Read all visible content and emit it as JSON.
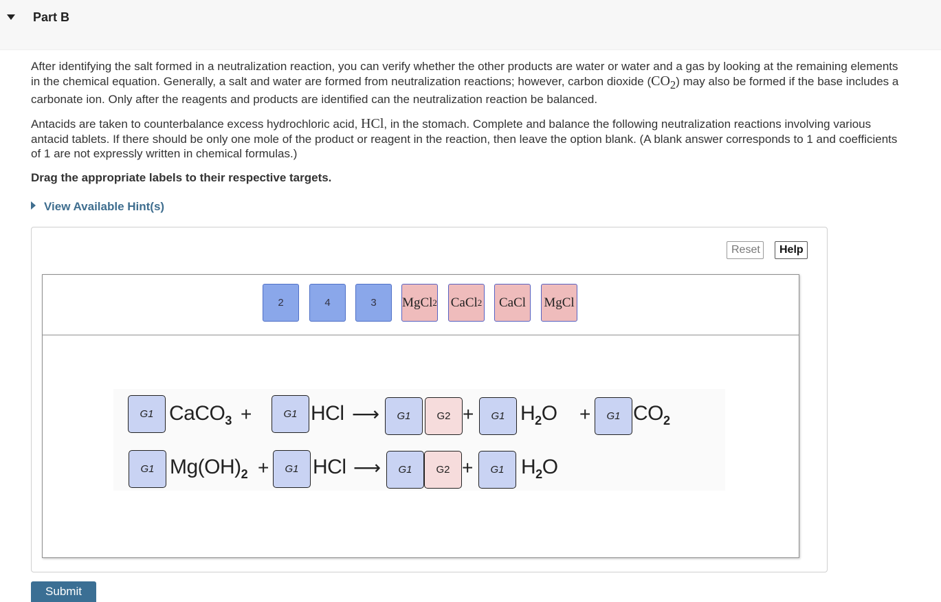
{
  "part": {
    "title": "Part B"
  },
  "paragraph1": {
    "l1": "After identifying the salt formed in a neutralization reaction, you can verify whether the other products are water or water and a gas by looking at the remaining elements",
    "l2a": "in the chemical equation. Generally, a salt and water are formed from neutralization reactions; however, carbon dioxide (",
    "l2chem": "CO",
    "l2sub": "2",
    "l2b": ") may also be formed if the base includes a",
    "l3": "carbonate ion. Only after the reagents and products are identified can the neutralization reaction be balanced."
  },
  "paragraph2": {
    "l1a": "Antacids are taken to counterbalance excess hydrochloric acid, ",
    "l1chem": "HCl",
    "l1b": ", in the stomach. Complete and balance the following neutralization reactions involving various",
    "l2": "antacid tablets. If there should be only one mole of the product or reagent in the reaction, then leave the option blank. (A blank answer corresponds to 1 and coefficients",
    "l3": "of 1 are not expressly written in chemical formulas.)"
  },
  "instruction": "Drag the appropriate labels to their respective targets.",
  "hint_link": "View Available Hint(s)",
  "toolbar": {
    "reset": "Reset",
    "help": "Help"
  },
  "labels": {
    "n1": "2",
    "n2": "4",
    "n3": "3",
    "s1": {
      "base": "MgCl",
      "sub": "2"
    },
    "s2": {
      "base": "CaCl",
      "sub": "2"
    },
    "s3": "CaCl",
    "s4": "MgCl"
  },
  "equations": {
    "g1": "G1",
    "g2": "G2",
    "plus": "+",
    "arrow": "⟶",
    "eq1": {
      "reactant1": {
        "base": "CaCO",
        "sub": "3"
      },
      "reactant2": "HCl",
      "product2": {
        "base": "H",
        "sub": "2",
        "tail": "O"
      },
      "product3": {
        "base": "CO",
        "sub": "2"
      }
    },
    "eq2": {
      "reactant1": {
        "base": "Mg(OH)",
        "sub": "2"
      },
      "reactant2": "HCl",
      "product2": {
        "base": "H",
        "sub": "2",
        "tail": "O"
      }
    }
  },
  "submit_label": "Submit"
}
